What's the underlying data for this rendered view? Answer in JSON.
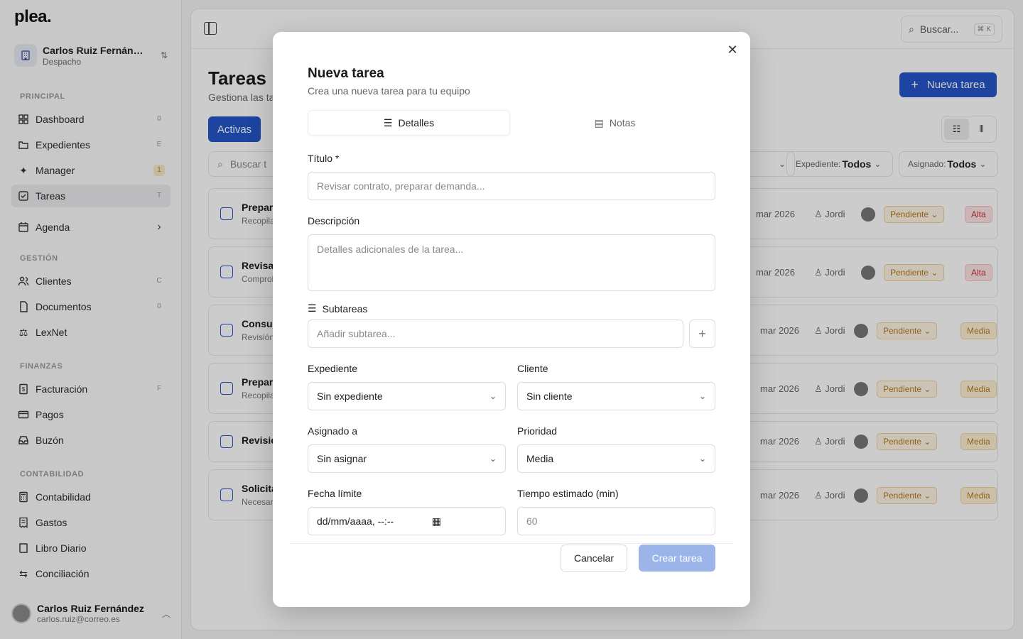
{
  "brand": {
    "logo": "plea."
  },
  "account": {
    "name": "Carlos Ruiz Fernán…",
    "type": "Despacho"
  },
  "sidebar": {
    "sections": [
      {
        "label": "PRINCIPAL"
      },
      {
        "label": "GESTIÓN"
      },
      {
        "label": "FINANZAS"
      },
      {
        "label": "CONTABILIDAD"
      }
    ],
    "items": [
      {
        "label": "Dashboard",
        "badge": "0",
        "icon": "dashboard-icon"
      },
      {
        "label": "Expedientes",
        "badge": "E",
        "icon": "folder-icon"
      },
      {
        "label": "Manager",
        "badge": "1",
        "icon": "sparkle-icon"
      },
      {
        "label": "Tareas",
        "badge": "T",
        "icon": "check-square-icon"
      },
      {
        "label": "Agenda",
        "badge": "›",
        "icon": "calendar-icon"
      },
      {
        "label": "Clientes",
        "badge": "C",
        "icon": "users-icon"
      },
      {
        "label": "Documentos",
        "badge": "0",
        "icon": "document-icon"
      },
      {
        "label": "LexNet",
        "badge": "",
        "icon": "scale-icon"
      },
      {
        "label": "Facturación",
        "badge": "F",
        "icon": "invoice-icon"
      },
      {
        "label": "Pagos",
        "badge": "",
        "icon": "card-icon"
      },
      {
        "label": "Buzón",
        "badge": "",
        "icon": "inbox-icon"
      },
      {
        "label": "Contabilidad",
        "badge": "",
        "icon": "calculator-icon"
      },
      {
        "label": "Gastos",
        "badge": "",
        "icon": "receipt-icon"
      },
      {
        "label": "Libro Diario",
        "badge": "",
        "icon": "book-icon"
      },
      {
        "label": "Conciliación",
        "badge": "",
        "icon": "arrows-icon"
      }
    ],
    "user": {
      "name": "Carlos Ruiz Fernández",
      "email": "carlos.ruiz@correo.es"
    }
  },
  "topbar": {
    "search_label": "Buscar...",
    "shortcut": "⌘ K"
  },
  "page": {
    "title": "Tareas",
    "subtitle": "Gestiona las ta",
    "new_button": "Nueva tarea",
    "tab_active": "Activas",
    "search_placeholder": "Buscar t",
    "filters": [
      {
        "label": "Expediente:",
        "value": "Todos"
      },
      {
        "label": "Asignado:",
        "value": "Todos"
      }
    ],
    "tasks": [
      {
        "title": "Prepar",
        "sub": "Recopila",
        "date": "mar 2026",
        "assignee": "Jordi",
        "status": "Pendiente",
        "priority": "Alta"
      },
      {
        "title": "Revisa",
        "sub": "Comprol",
        "date": "mar 2026",
        "assignee": "Jordi",
        "status": "Pendiente",
        "priority": "Alta"
      },
      {
        "title": "Consul",
        "sub": "Revisión",
        "date": "mar 2026",
        "assignee": "Jordi",
        "status": "Pendiente",
        "priority": "Media"
      },
      {
        "title": "Prepar",
        "sub": "Recopila",
        "date": "mar 2026",
        "assignee": "Jordi",
        "status": "Pendiente",
        "priority": "Media"
      },
      {
        "title": "Revisió",
        "sub": "",
        "date": "mar 2026",
        "assignee": "Jordi",
        "status": "Pendiente",
        "priority": "Media"
      },
      {
        "title": "Solicita",
        "sub": "Necesar",
        "date": "mar 2026",
        "assignee": "Jordi",
        "status": "Pendiente",
        "priority": "Media"
      }
    ]
  },
  "modal": {
    "title": "Nueva tarea",
    "subtitle": "Crea una nueva tarea para tu equipo",
    "tabs": [
      {
        "label": "Detalles"
      },
      {
        "label": "Notas"
      }
    ],
    "title_label": "Título *",
    "title_placeholder": "Revisar contrato, preparar demanda...",
    "desc_label": "Descripción",
    "desc_placeholder": "Detalles adicionales de la tarea...",
    "subtasks_label": "Subtareas",
    "subtask_placeholder": "Añadir subtarea...",
    "expediente_label": "Expediente",
    "expediente_value": "Sin expediente",
    "cliente_label": "Cliente",
    "cliente_value": "Sin cliente",
    "asignado_label": "Asignado a",
    "asignado_value": "Sin asignar",
    "prioridad_label": "Prioridad",
    "prioridad_value": "Media",
    "fecha_label": "Fecha límite",
    "fecha_placeholder": "dd/mm/aaaa, --:--",
    "tiempo_label": "Tiempo estimado (min)",
    "tiempo_placeholder": "60",
    "cancel": "Cancelar",
    "create": "Crear tarea"
  }
}
